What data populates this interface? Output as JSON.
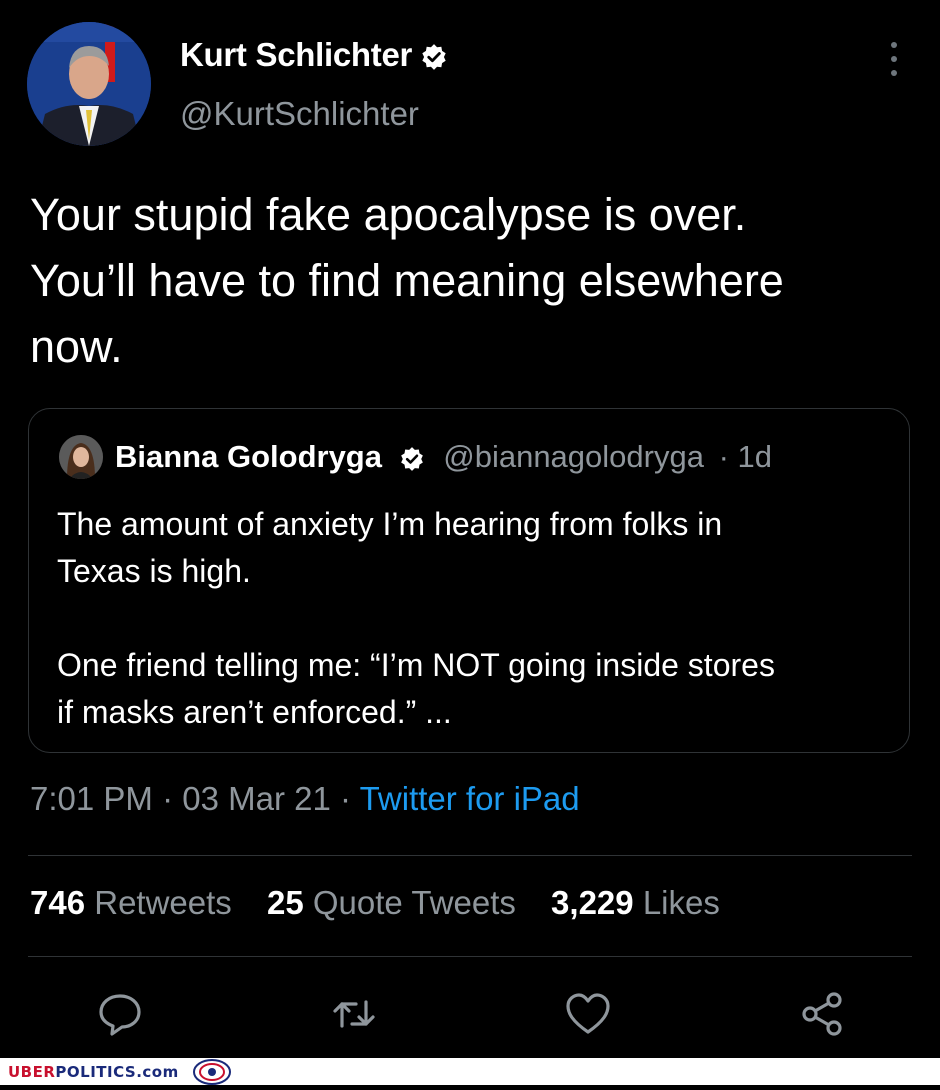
{
  "author": {
    "name": "Kurt Schlichter",
    "handle": "@KurtSchlichter"
  },
  "tweet": {
    "text": "Your stupid fake apocalypse is over.\nYou’ll have to find meaning elsewhere\nnow."
  },
  "quoted": {
    "name": "Bianna Golodryga",
    "handle": "@biannagolodryga",
    "age": "· 1d",
    "text": "The amount of anxiety I’m hearing from folks in\nTexas is high.\n\nOne friend telling me: “I’m NOT going inside stores\nif masks aren’t enforced.” ..."
  },
  "meta": {
    "time": "7:01 PM",
    "date": "· 03 Mar 21 ·",
    "source": "Twitter for iPad"
  },
  "stats": {
    "retweets_count": "746",
    "retweets_label": "Retweets",
    "quotes_count": "25",
    "quotes_label": "Quote Tweets",
    "likes_count": "3,229",
    "likes_label": "Likes"
  },
  "icons": [
    "reply-icon",
    "retweet-icon",
    "like-icon",
    "share-icon",
    "more-icon",
    "verified-icon"
  ],
  "footer": {
    "brand_uber": "UBER",
    "brand_politics": "POLITICS",
    "brand_com": ".com"
  },
  "colors": {
    "background": "#000000",
    "link": "#1d9bf0",
    "secondary_text": "#8f969c"
  }
}
